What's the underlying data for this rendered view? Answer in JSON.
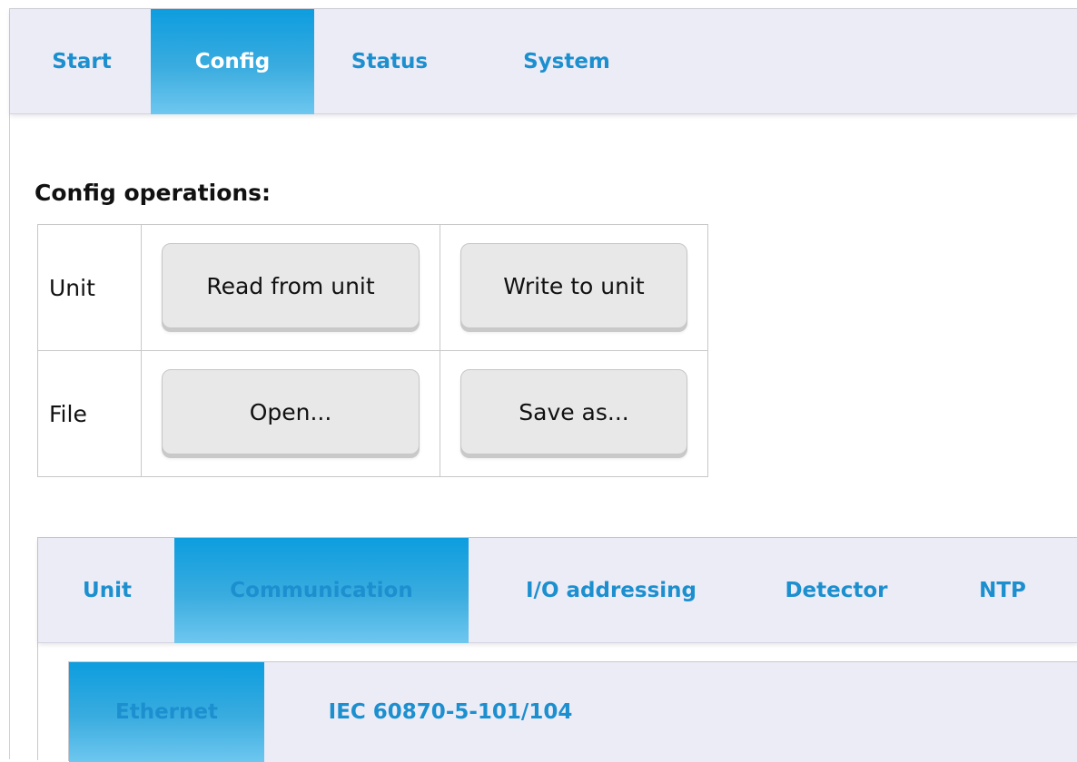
{
  "top_nav": {
    "tabs": [
      {
        "label": "Start"
      },
      {
        "label": "Config"
      },
      {
        "label": "Status"
      },
      {
        "label": "System"
      }
    ],
    "active": "Config"
  },
  "config_operations": {
    "heading": "Config operations:",
    "rows": [
      {
        "label": "Unit",
        "buttons": [
          "Read from unit",
          "Write to unit"
        ]
      },
      {
        "label": "File",
        "buttons": [
          "Open...",
          "Save as..."
        ]
      }
    ]
  },
  "config_tabs": {
    "tabs": [
      {
        "label": "Unit"
      },
      {
        "label": "Communication"
      },
      {
        "label": "I/O addressing"
      },
      {
        "label": "Detector"
      },
      {
        "label": "NTP"
      }
    ],
    "active": "Communication"
  },
  "communication_tabs": {
    "tabs": [
      {
        "label": "Ethernet"
      },
      {
        "label": "IEC 60870-5-101/104"
      }
    ],
    "active": "Ethernet"
  },
  "colors": {
    "accent": "#1c8fcf",
    "active_tab_top": "#0d9ddf",
    "active_tab_bottom": "#6ec7ef",
    "nav_background": "#ececf7",
    "button_background": "#e8e8e8"
  }
}
